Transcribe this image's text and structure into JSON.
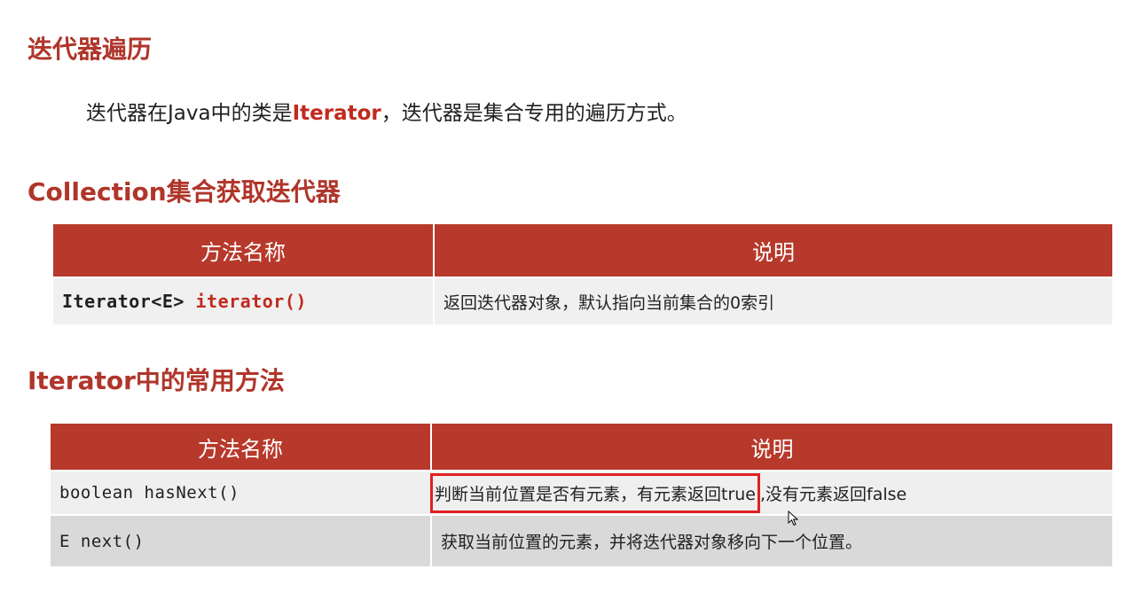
{
  "section1": {
    "title": "迭代器遍历",
    "intro_prefix": "迭代器在Java中的类是",
    "intro_accent": "Iterator",
    "intro_suffix": "，迭代器是集合专用的遍历方式。"
  },
  "section2": {
    "title": "Collection集合获取迭代器",
    "table": {
      "headers": [
        "方法名称",
        "说明"
      ],
      "rows": [
        {
          "method_type": "Iterator<E> ",
          "method_name": "iterator()",
          "description": "返回迭代器对象，默认指向当前集合的0索引"
        }
      ]
    }
  },
  "section3": {
    "title": "Iterator中的常用方法",
    "table": {
      "headers": [
        "方法名称",
        "说明"
      ],
      "rows": [
        {
          "method": "boolean hasNext()",
          "description_highlighted": "判断当前位置是否有元素，有元素返回true",
          "description_rest": ",没有元素返回false"
        },
        {
          "method": "E next()",
          "description": "获取当前位置的元素，并将迭代器对象移向下一个位置。"
        }
      ]
    }
  },
  "colors": {
    "accent": "#b0352a",
    "header_bg": "#b7392b",
    "highlight_border": "#e02020"
  }
}
